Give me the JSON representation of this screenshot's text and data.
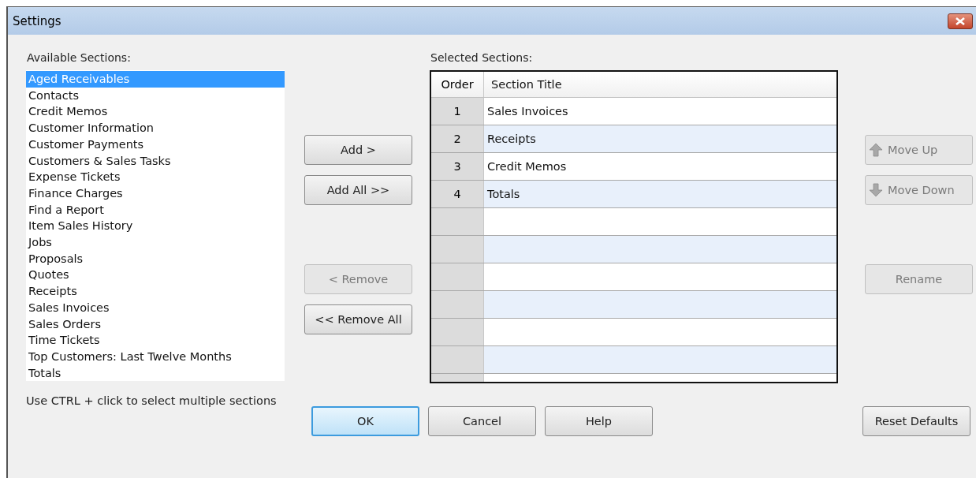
{
  "window": {
    "title": "Settings"
  },
  "available": {
    "label": "Available Sections:",
    "items": [
      {
        "text": "Aged Receivables",
        "selected": true
      },
      {
        "text": "Contacts",
        "selected": false
      },
      {
        "text": "Credit Memos",
        "selected": false
      },
      {
        "text": "Customer Information",
        "selected": false
      },
      {
        "text": "Customer Payments",
        "selected": false
      },
      {
        "text": "Customers & Sales Tasks",
        "selected": false
      },
      {
        "text": "Expense Tickets",
        "selected": false
      },
      {
        "text": "Finance Charges",
        "selected": false
      },
      {
        "text": "Find a Report",
        "selected": false
      },
      {
        "text": "Item Sales History",
        "selected": false
      },
      {
        "text": "Jobs",
        "selected": false
      },
      {
        "text": "Proposals",
        "selected": false
      },
      {
        "text": "Quotes",
        "selected": false
      },
      {
        "text": "Receipts",
        "selected": false
      },
      {
        "text": "Sales Invoices",
        "selected": false
      },
      {
        "text": "Sales Orders",
        "selected": false
      },
      {
        "text": "Time Tickets",
        "selected": false
      },
      {
        "text": "Top Customers: Last Twelve Months",
        "selected": false
      },
      {
        "text": "Totals",
        "selected": false
      }
    ],
    "hint": "Use CTRL + click to select multiple sections"
  },
  "transfer_buttons": [
    {
      "label": "Add >",
      "disabled": false
    },
    {
      "label": "Add All >>",
      "disabled": false
    },
    {
      "label": "< Remove",
      "disabled": true
    },
    {
      "label": "<< Remove All",
      "disabled": false
    }
  ],
  "selected": {
    "label": "Selected Sections:",
    "columns": [
      "Order",
      "Section Title"
    ],
    "rows": [
      {
        "order": "1",
        "title": "Sales Invoices"
      },
      {
        "order": "2",
        "title": "Receipts"
      },
      {
        "order": "3",
        "title": "Credit Memos"
      },
      {
        "order": "4",
        "title": "Totals"
      }
    ]
  },
  "side_buttons": [
    {
      "label": "Move Up",
      "disabled": true,
      "kind": "up"
    },
    {
      "label": "Move Down",
      "disabled": true,
      "kind": "down"
    },
    {
      "label": "Rename",
      "disabled": true,
      "kind": "plain"
    }
  ],
  "footer_buttons": [
    {
      "label": "OK",
      "default": true
    },
    {
      "label": "Cancel",
      "default": false
    },
    {
      "label": "Help",
      "default": false
    }
  ],
  "reset_button": {
    "label": "Reset Defaults"
  }
}
